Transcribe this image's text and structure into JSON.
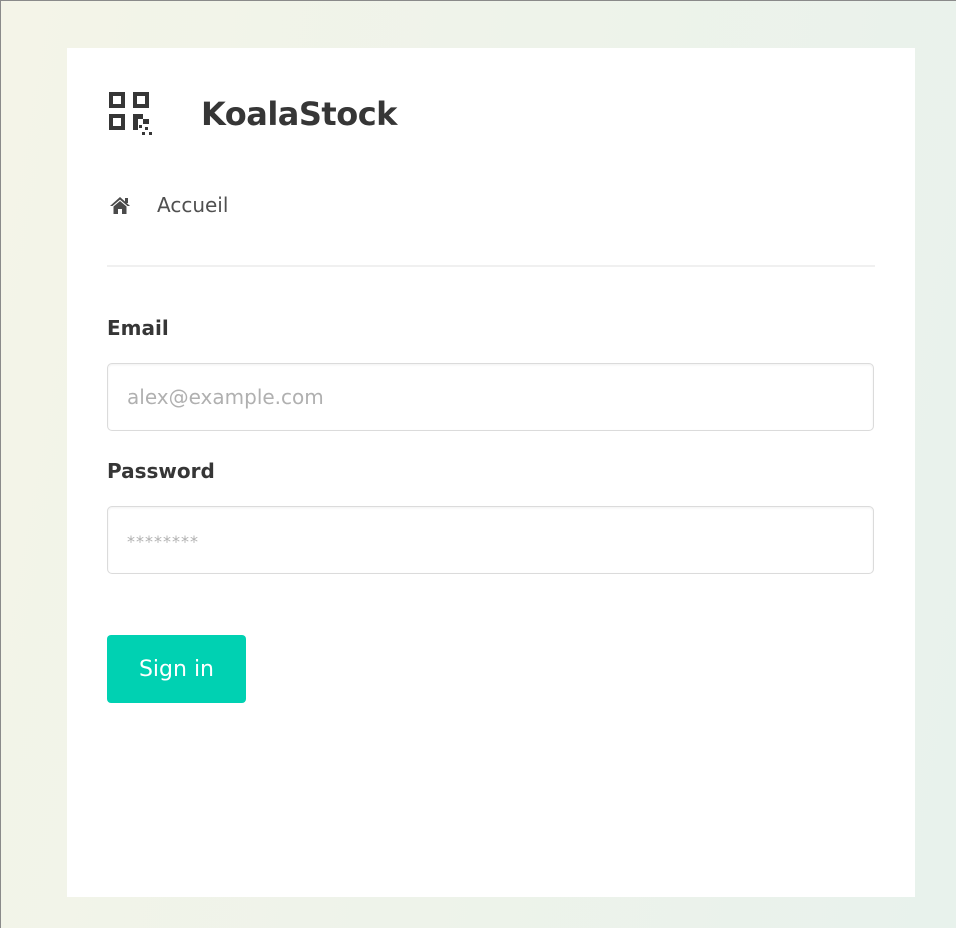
{
  "brand": {
    "name": "KoalaStock",
    "icon": "qrcode-icon"
  },
  "breadcrumb": {
    "icon": "home-icon",
    "label": "Accueil"
  },
  "form": {
    "email": {
      "label": "Email",
      "value": "",
      "placeholder": "alex@example.com"
    },
    "password": {
      "label": "Password",
      "value": "",
      "placeholder": "********"
    },
    "submit_label": "Sign in"
  },
  "colors": {
    "primary": "#00d1b2",
    "text": "#363636",
    "background_gradient": [
      "#f4f4e8",
      "#e8f2ec"
    ]
  }
}
